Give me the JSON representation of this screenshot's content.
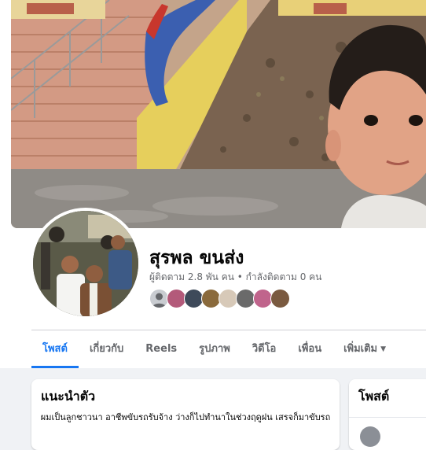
{
  "profile": {
    "name": "สุรพล ขนส่ง",
    "stats": "ผู้ติดตาม 2.8 พัน คน • กำลังติดตาม 0 คน",
    "friend_avatars": [
      {
        "icon": "default-avatar-icon",
        "color": "#c9ccd1"
      },
      {
        "icon": "friend-avatar",
        "color": "#b35a7a"
      },
      {
        "icon": "friend-avatar",
        "color": "#3e4a5a"
      },
      {
        "icon": "friend-avatar",
        "color": "#8a6a3c"
      },
      {
        "icon": "friend-avatar",
        "color": "#d7c9b8"
      },
      {
        "icon": "friend-avatar",
        "color": "#6a6a6a"
      },
      {
        "icon": "friend-avatar",
        "color": "#c0648c"
      },
      {
        "icon": "friend-avatar",
        "color": "#7a5a40"
      }
    ]
  },
  "tabs": [
    {
      "label": "โพสต์",
      "active": true
    },
    {
      "label": "เกี่ยวกับ",
      "active": false
    },
    {
      "label": "Reels",
      "active": false
    },
    {
      "label": "รูปภาพ",
      "active": false
    },
    {
      "label": "วิดีโอ",
      "active": false
    },
    {
      "label": "เพื่อน",
      "active": false
    },
    {
      "label": "เพิ่มเติม",
      "active": false,
      "icon": "caret-down-icon"
    }
  ],
  "intro": {
    "title": "แนะนำตัว",
    "bio": "ผมเป็นลูกชาวนา อาชีพขับรถรับจ้าง ว่างก็ไปทำนาในช่วงฤดูฝน เสรจก็มาขับรถ"
  },
  "posts_panel": {
    "title": "โพสต์"
  },
  "colors": {
    "accent": "#1877f2",
    "text": "#050505",
    "secondary_text": "#65676b",
    "page_bg": "#f0f2f5"
  }
}
